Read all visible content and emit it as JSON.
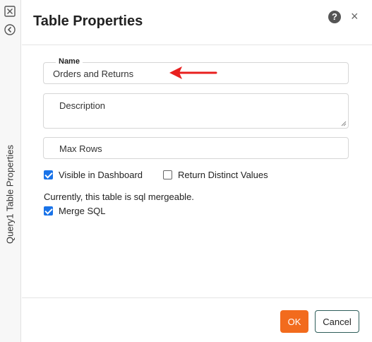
{
  "rail": {
    "close_icon": "close-square-icon",
    "back_icon": "chevron-left-circle-icon",
    "title": "Query1 Table Properties"
  },
  "dialog": {
    "title": "Table Properties",
    "help_icon": "question-circle-icon",
    "help_glyph": "?",
    "close_glyph": "×"
  },
  "form": {
    "name": {
      "label": "Name",
      "value": "Orders and Returns"
    },
    "description": {
      "placeholder": "Description",
      "value": ""
    },
    "max_rows": {
      "placeholder": "Max Rows",
      "value": ""
    },
    "visible_in_dashboard": {
      "label": "Visible in Dashboard",
      "checked": true
    },
    "return_distinct": {
      "label": "Return Distinct Values",
      "checked": false
    },
    "mergeable_info": "Currently, this table is sql mergeable.",
    "merge_sql": {
      "label": "Merge SQL",
      "checked": true
    }
  },
  "annotation": {
    "arrow_color": "#e8201f",
    "icon": "red-arrow-icon"
  },
  "footer": {
    "ok_label": "OK",
    "cancel_label": "Cancel"
  },
  "colors": {
    "accent": "#f26b1d",
    "checkbox": "#1a73e8",
    "cancel_border": "#2f5e5a"
  }
}
